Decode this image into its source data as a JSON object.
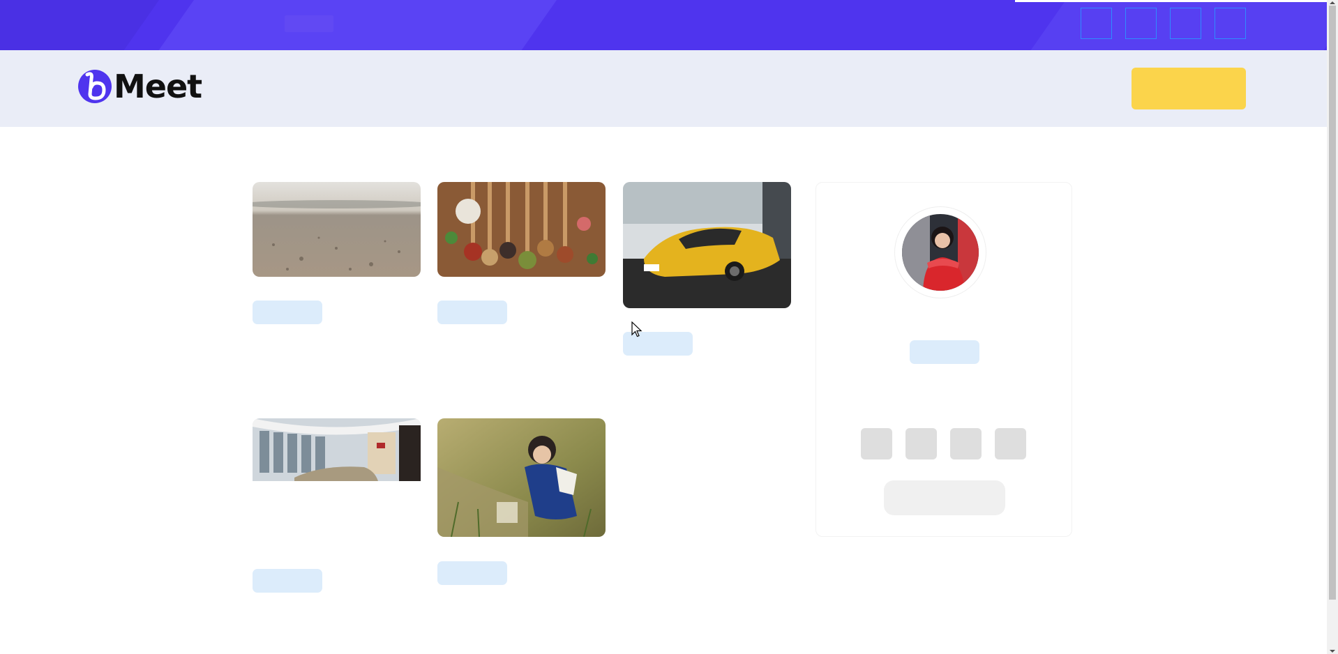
{
  "app": {
    "logo_text": "Meet",
    "brand_color": "#4f34ee",
    "accent_color": "#fbd44b"
  },
  "topbar": {
    "social_icons": [
      "social-icon-1",
      "social-icon-2",
      "social-icon-3",
      "social-icon-4"
    ]
  },
  "header": {
    "cta_label": ""
  },
  "gallery": {
    "items": [
      {
        "image": "sandy-beach-closeup-photo",
        "tag": ""
      },
      {
        "image": "spices-on-wooden-spoons-photo",
        "tag": ""
      },
      {
        "image": "yellow-sports-car-photo",
        "tag": ""
      },
      {
        "image": "car-showroom-interior-photo",
        "tag": ""
      },
      {
        "image": "child-crouching-by-water-photo",
        "tag": ""
      }
    ]
  },
  "profile": {
    "avatar": "woman-in-red-dress-photo",
    "name": "",
    "social_icons": [
      "profile-social-icon-1",
      "profile-social-icon-2",
      "profile-social-icon-3",
      "profile-social-icon-4"
    ],
    "button_label": ""
  }
}
